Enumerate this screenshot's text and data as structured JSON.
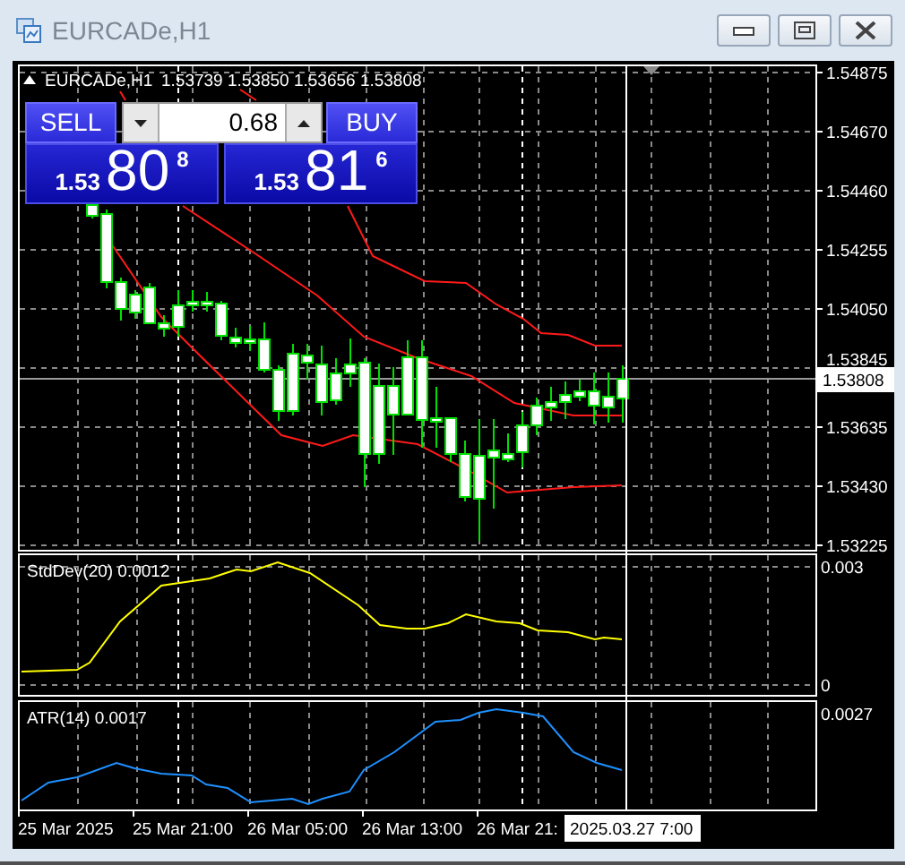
{
  "window": {
    "title": "EURCADe,H1"
  },
  "chart": {
    "symbol": "EURCADe,H1",
    "ohlc": "1.53739 1.53850 1.53656 1.53808",
    "one_click": {
      "sell_label": "SELL",
      "buy_label": "BUY",
      "lot": "0.68",
      "bid": {
        "prefix": "1.53",
        "big": "80",
        "pip": "8"
      },
      "ask": {
        "prefix": "1.53",
        "big": "81",
        "pip": "6"
      }
    },
    "price_axis": [
      "1.54875",
      "1.54670",
      "1.54460",
      "1.54255",
      "1.54050",
      "1.53845",
      "1.53635",
      "1.53430",
      "1.53225"
    ],
    "current_price": "1.53808",
    "stddev_panel": {
      "label": "StdDev(20) 0.0012",
      "axis_labels": [
        "0.003",
        "0"
      ]
    },
    "atr_panel": {
      "label": "ATR(14) 0.0017",
      "axis_label": "0.0027"
    },
    "time_axis": [
      "25 Mar 2025",
      "25 Mar 21:00",
      "26 Mar 05:00",
      "26 Mar 13:00",
      "26 Mar 21:"
    ],
    "cursor_time": "2025.03.27 7:00"
  }
}
